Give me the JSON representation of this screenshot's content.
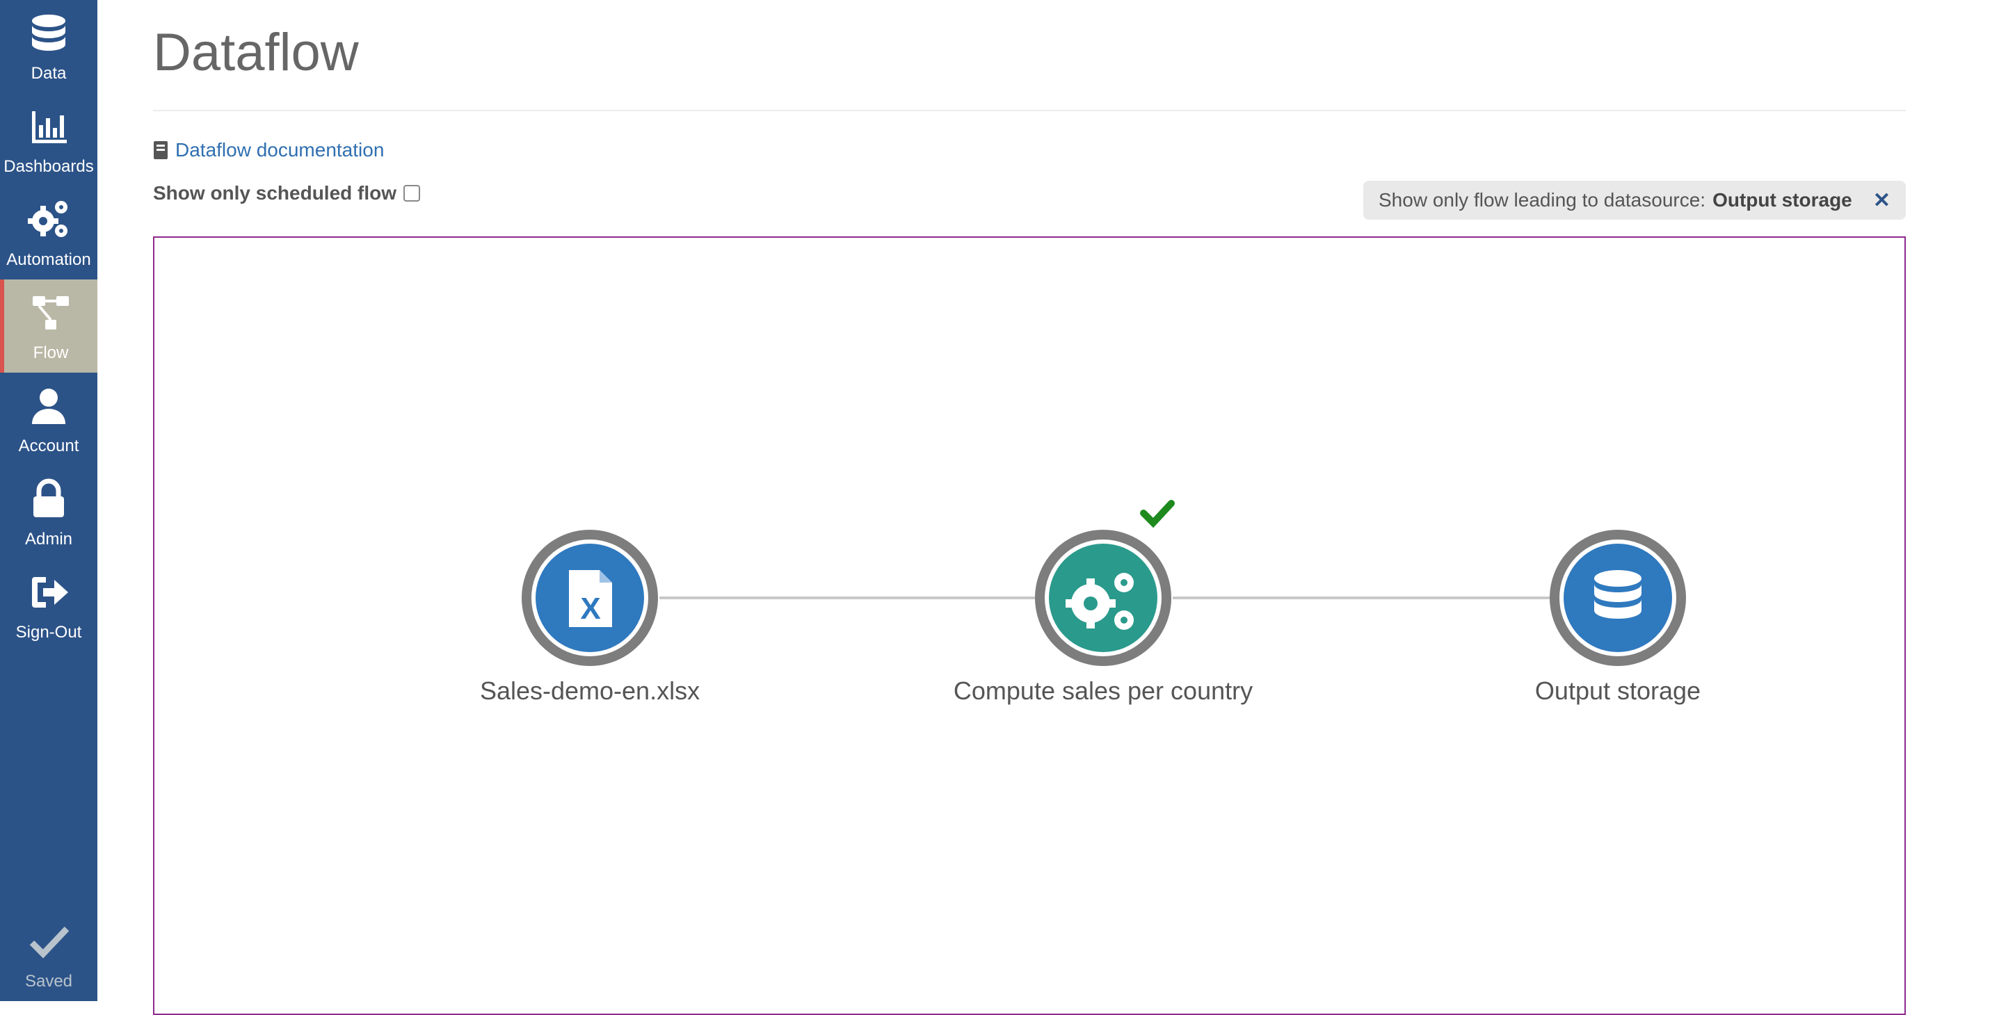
{
  "sidebar": {
    "items": [
      {
        "label": "Data",
        "icon": "database-icon"
      },
      {
        "label": "Dashboards",
        "icon": "bar-chart-icon"
      },
      {
        "label": "Automation",
        "icon": "gears-icon"
      },
      {
        "label": "Flow",
        "icon": "flow-icon",
        "active": true
      },
      {
        "label": "Account",
        "icon": "user-icon"
      },
      {
        "label": "Admin",
        "icon": "lock-icon"
      },
      {
        "label": "Sign-Out",
        "icon": "sign-out-icon"
      }
    ],
    "status": {
      "label": "Saved",
      "icon": "check-icon"
    }
  },
  "page": {
    "title": "Dataflow",
    "doc_link": "Dataflow documentation",
    "scheduled_label": "Show only scheduled flow",
    "scheduled_checked": false,
    "filter": {
      "prefix": "Show only flow leading to datasource:",
      "datasource": "Output storage",
      "close": "✕"
    }
  },
  "flow": {
    "nodes": [
      {
        "label": "Sales-demo-en.xlsx",
        "type": "excel-file",
        "color": "#2f79bf"
      },
      {
        "label": "Compute sales per country",
        "type": "automation",
        "color": "#2a9a8c",
        "status": "success"
      },
      {
        "label": "Output storage",
        "type": "datasource",
        "color": "#2f79bf"
      }
    ],
    "edges": [
      {
        "from": 0,
        "to": 1
      },
      {
        "from": 1,
        "to": 2
      }
    ]
  },
  "colors": {
    "sidebar": "#2c5388",
    "active_nav": "#b9b8a6",
    "active_accent": "#d9534f",
    "canvas_border": "#8e2a8e",
    "success": "#1e8a1e",
    "link": "#2f6fb0"
  }
}
